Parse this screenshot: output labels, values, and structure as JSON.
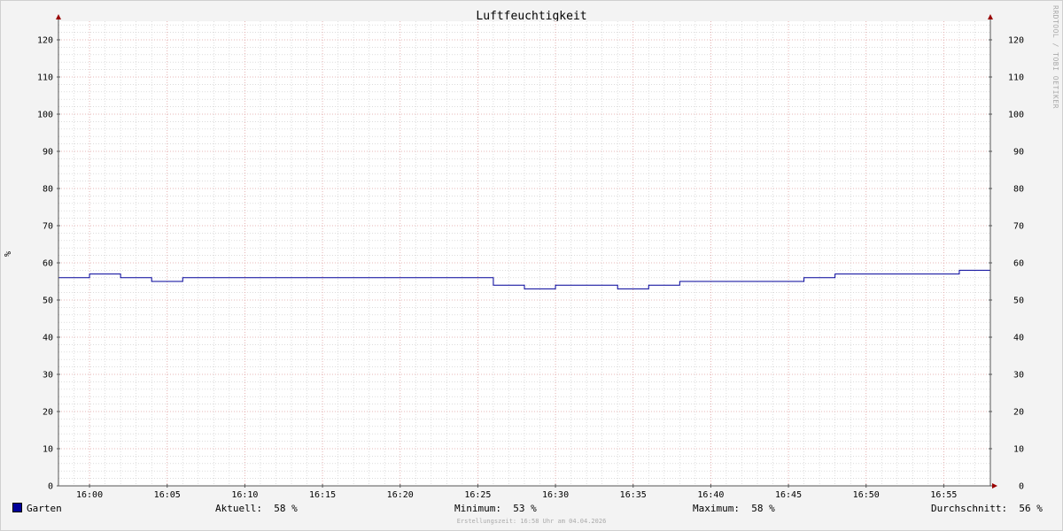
{
  "watermark": "RRDTOOL / TOBI OETIKER",
  "chart_data": {
    "type": "line",
    "title": "Luftfeuchtigkeit",
    "ylabel": "%",
    "ylim": [
      0,
      125
    ],
    "yticks": [
      0,
      10,
      20,
      30,
      40,
      50,
      60,
      70,
      80,
      90,
      100,
      110,
      120
    ],
    "xlim_minutes": [
      -2,
      58
    ],
    "xticks": [
      {
        "label": "16:00",
        "minute": 0
      },
      {
        "label": "16:05",
        "minute": 5
      },
      {
        "label": "16:10",
        "minute": 10
      },
      {
        "label": "16:15",
        "minute": 15
      },
      {
        "label": "16:20",
        "minute": 20
      },
      {
        "label": "16:25",
        "minute": 25
      },
      {
        "label": "16:30",
        "minute": 30
      },
      {
        "label": "16:35",
        "minute": 35
      },
      {
        "label": "16:40",
        "minute": 40
      },
      {
        "label": "16:45",
        "minute": 45
      },
      {
        "label": "16:50",
        "minute": 50
      },
      {
        "label": "16:55",
        "minute": 55
      }
    ],
    "grid": true,
    "series": [
      {
        "name": "Garten",
        "color": "#000099",
        "steps": [
          {
            "from": -2,
            "value": 56
          },
          {
            "from": 0,
            "value": 57
          },
          {
            "from": 2,
            "value": 56
          },
          {
            "from": 4,
            "value": 55
          },
          {
            "from": 6,
            "value": 56
          },
          {
            "from": 26,
            "value": 54
          },
          {
            "from": 28,
            "value": 53
          },
          {
            "from": 30,
            "value": 54
          },
          {
            "from": 34,
            "value": 53
          },
          {
            "from": 36,
            "value": 54
          },
          {
            "from": 38,
            "value": 55
          },
          {
            "from": 46,
            "value": 56
          },
          {
            "from": 48,
            "value": 57
          },
          {
            "from": 56,
            "value": 58
          }
        ]
      }
    ]
  },
  "legend": {
    "series_name": "Garten",
    "aktuell_label": "Aktuell:",
    "aktuell_value": "58 %",
    "minimum_label": "Minimum:",
    "minimum_value": "53 %",
    "maximum_label": "Maximum:",
    "maximum_value": "58 %",
    "avg_label": "Durchschnitt:",
    "avg_value": "56 %"
  },
  "footer": "Erstellungszeit: 16:58 Uhr am 04.04.2026",
  "colors": {
    "background": "#f3f3f3",
    "canvas": "#ffffff",
    "line": "#000099",
    "major_grid": "#e0a0a0",
    "minor_grid": "#c8c8c8",
    "axis": "#555555",
    "arrow": "#990000"
  }
}
